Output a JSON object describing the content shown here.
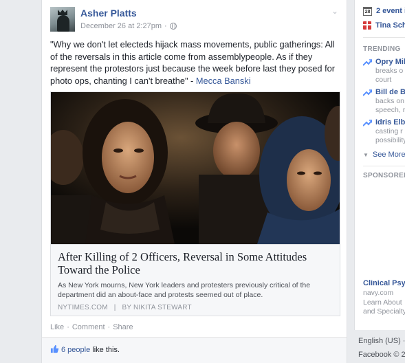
{
  "post": {
    "author": "Asher Platts",
    "timestamp": "December 26 at 2:27pm",
    "separator": "·",
    "caption_text": "\"Why we don't let electeds hijack mass movements, public gatherings: All of the reversals in this article come from assemblypeople. As if they represent the protestors just because the week before last they posed for photo ops, chanting I can't breathe\" - ",
    "caption_source": "Mecca Banski",
    "link": {
      "title": "After Killing of 2 Officers, Reversal in Some Attitudes Toward the Police",
      "description": "As New York mourns, New York leaders and protesters previously critical of the department did an about-face and protests seemed out of place.",
      "source": "NYTIMES.COM",
      "source_sep": "|",
      "byline": "BY NIKITA STEWART"
    },
    "actions": {
      "like": "Like",
      "comment": "Comment",
      "share": "Share",
      "dot": "·"
    },
    "likes": {
      "count": "6 people",
      "suffix": " like this."
    }
  },
  "sidebar": {
    "events": {
      "calendar_num": "28",
      "label": "2 event i"
    },
    "birthday": {
      "label": "Tina Sch"
    },
    "trending_heading": "TRENDING",
    "trending": [
      {
        "title": "Opry Mil",
        "desc": "breaks o\ncourt"
      },
      {
        "title": "Bill de B",
        "desc": "backs on\nspeech, r"
      },
      {
        "title": "Idris Elb",
        "desc": "casting r\npossibility"
      }
    ],
    "see_more": "See More",
    "sponsored_heading": "SPONSORED",
    "ad": {
      "title": "Clinical Psyc",
      "domain": "navy.com",
      "body": "Learn About\nand Specialty"
    },
    "footer_lang": "English (US) ·",
    "footer_copy": "Facebook © 2"
  },
  "colors": {
    "link_blue": "#365899",
    "meta_grey": "#90949c",
    "page_bg": "#e9ebee"
  }
}
